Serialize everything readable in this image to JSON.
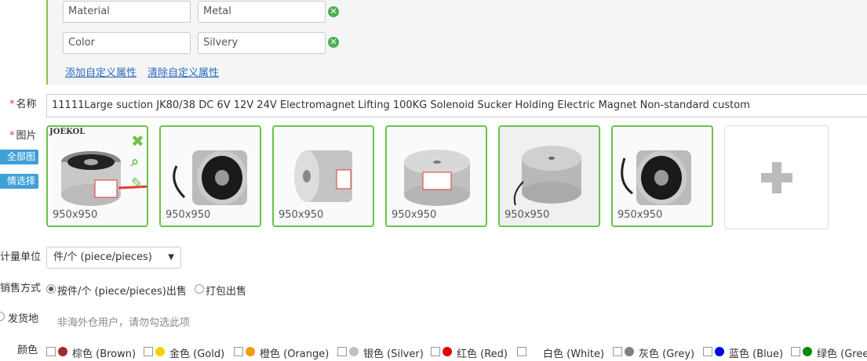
{
  "attributes": [
    {
      "name": "Material",
      "value": "Metal"
    },
    {
      "name": "Color",
      "value": "Silvery"
    }
  ],
  "attr_links": {
    "add": "添加自定义属性",
    "clear": "清除自定义属性"
  },
  "name_field": {
    "label": "名称",
    "value": "11111Large suction JK80/38 DC 6V 12V 24V Electromagnet Lifting 100KG Solenoid Sucker Holding Electric Magnet Non-standard custom"
  },
  "images": {
    "label": "图片",
    "items": [
      {
        "size": "950x950",
        "brand": "JOEKOL"
      },
      {
        "size": "950x950"
      },
      {
        "size": "950x950"
      },
      {
        "size": "950x950"
      },
      {
        "size": "950x950"
      },
      {
        "size": "950x950"
      }
    ],
    "side_buttons": [
      "全部图片",
      "情选择"
    ]
  },
  "unit": {
    "label": "计量单位",
    "value": "件/个 (piece/pieces)"
  },
  "sale": {
    "label": "销售方式",
    "options": [
      "按件/个 (piece/pieces)出售",
      "打包出售"
    ],
    "selected": 0
  },
  "ship": {
    "label": "发货地",
    "hint": "非海外仓用户，请勿勾选此项"
  },
  "colors": {
    "label": "颜色",
    "items": [
      {
        "name": "棕色 (Brown)",
        "hex": "#a52a2a"
      },
      {
        "name": "金色 (Gold)",
        "hex": "#f7d000"
      },
      {
        "name": "橙色 (Orange)",
        "hex": "#f39c12"
      },
      {
        "name": "银色 (Silver)",
        "hex": "#c0c0c0"
      },
      {
        "name": "红色 (Red)",
        "hex": "#e00000"
      },
      {
        "name": "白色 (White)",
        "hex": "#ffffff"
      },
      {
        "name": "灰色 (Grey)",
        "hex": "#808080"
      },
      {
        "name": "蓝色 (Blue)",
        "hex": "#0000e0"
      },
      {
        "name": "绿色 (Gree",
        "hex": "#0a8a0a"
      }
    ]
  }
}
